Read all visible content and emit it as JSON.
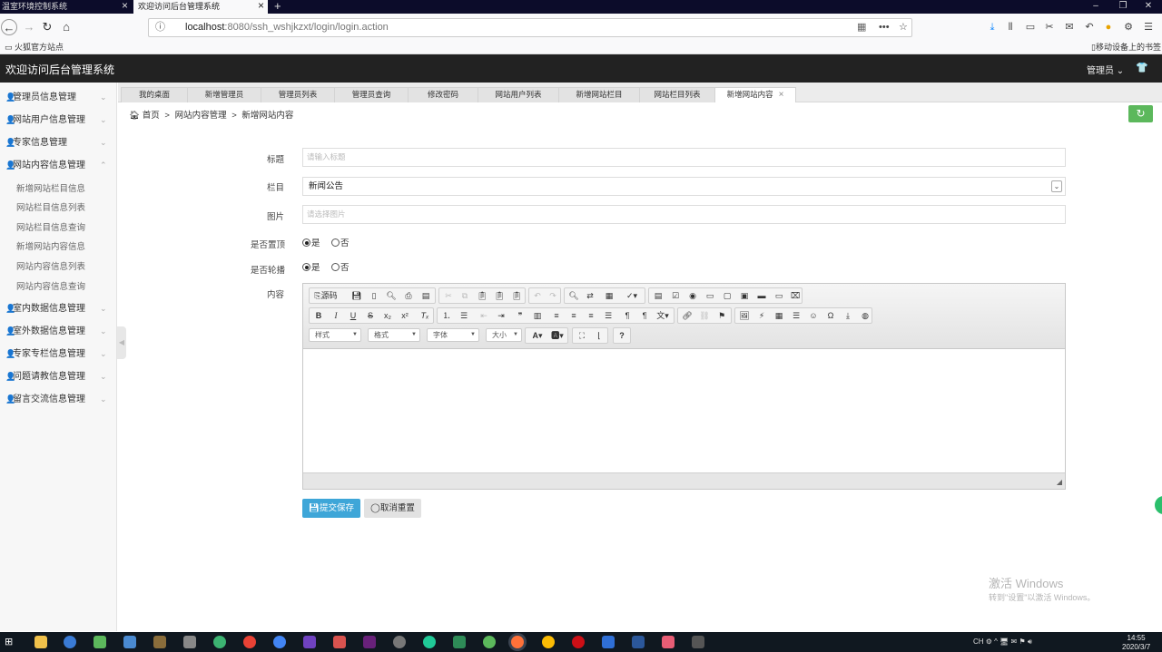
{
  "browser": {
    "tabs": [
      {
        "label": "温室环境控制系统"
      },
      {
        "label": "欢迎访问后台管理系统"
      }
    ],
    "url_host": "localhost",
    "url_rest": ":8080/ssh_wshjkzxt/login/login.action",
    "bookmark": "火狐官方站点",
    "mobile_bookmarks": "移动设备上的书签"
  },
  "header": {
    "title": "欢迎访问后台管理系统",
    "admin": "管理员"
  },
  "sidebar": {
    "items": [
      {
        "label": "管理员信息管理"
      },
      {
        "label": "网站用户信息管理"
      },
      {
        "label": "专家信息管理"
      },
      {
        "label": "网站内容信息管理"
      },
      {
        "label": "室内数据信息管理"
      },
      {
        "label": "室外数据信息管理"
      },
      {
        "label": "专家专栏信息管理"
      },
      {
        "label": "问题请教信息管理"
      },
      {
        "label": "留言交流信息管理"
      }
    ],
    "subitems": [
      {
        "label": "新增网站栏目信息"
      },
      {
        "label": "网站栏目信息列表"
      },
      {
        "label": "网站栏目信息查询"
      },
      {
        "label": "新增网站内容信息"
      },
      {
        "label": "网站内容信息列表"
      },
      {
        "label": "网站内容信息查询"
      }
    ]
  },
  "page_tabs": [
    {
      "label": "我的桌面"
    },
    {
      "label": "新增管理员"
    },
    {
      "label": "管理员列表"
    },
    {
      "label": "管理员查询"
    },
    {
      "label": "修改密码"
    },
    {
      "label": "网站用户列表"
    },
    {
      "label": "新增网站栏目"
    },
    {
      "label": "网站栏目列表"
    },
    {
      "label": "新增网站内容"
    }
  ],
  "breadcrumb": {
    "home": "首页",
    "level1": "网站内容管理",
    "level2": "新增网站内容",
    "sep": ">"
  },
  "form": {
    "title_label": "标题",
    "title_placeholder": "请输入标题",
    "column_label": "栏目",
    "column_value": "新闻公告",
    "image_label": "图片",
    "image_placeholder": "请选择图片",
    "top_label": "是否置顶",
    "carousel_label": "是否轮播",
    "yes": "是",
    "no": "否",
    "content_label": "内容"
  },
  "editor": {
    "source": "源码",
    "style": "样式",
    "format": "格式",
    "font": "字体",
    "size": "大小"
  },
  "buttons": {
    "save": "提交保存",
    "reset": "取消重置"
  },
  "watermark": {
    "line1": "激活 Windows",
    "line2": "转到\"设置\"以激活 Windows。"
  },
  "clock": {
    "time": "14:55",
    "date": "2020/3/7"
  },
  "colors": {
    "header_bg": "#222222",
    "save_button": "#3ea6d8",
    "refresh_button": "#5cb85c"
  }
}
